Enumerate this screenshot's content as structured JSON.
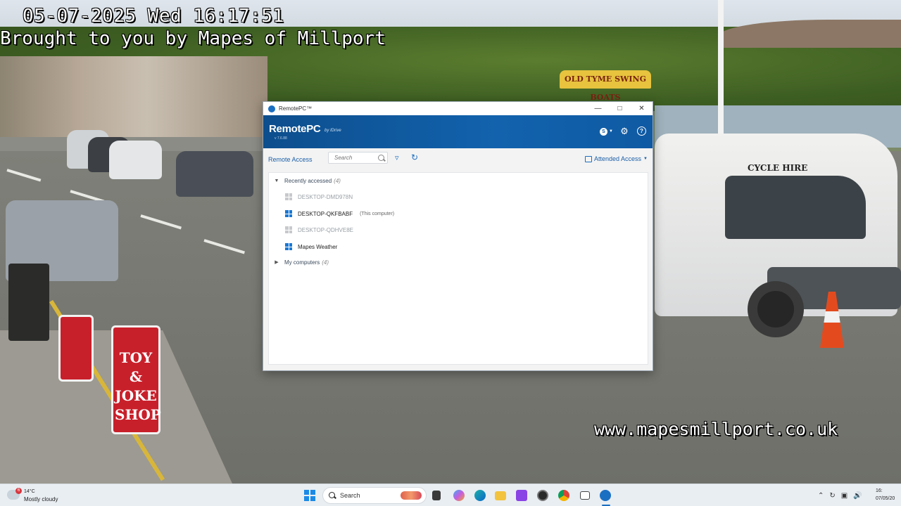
{
  "camera_overlay": {
    "datetime": "05-07-2025 Wed 16:17:51",
    "credit": "Brought to you by Mapes of Millport",
    "website": "www.mapesmillport.co.uk",
    "shop_sign": "TOY & JOKE SHOP",
    "banner": "OLD TYME SWING BOATS",
    "van_text": "CYCLE HIRE"
  },
  "window": {
    "title": "RemotePC™",
    "controls": {
      "minimize": "—",
      "maximize": "□",
      "close": "✕"
    }
  },
  "header": {
    "logo": "RemotePC",
    "logo_sub": "by IDrive",
    "version": "v 7.6.88",
    "user_initial": "S",
    "icons": {
      "user": "user-icon",
      "settings": "gear-icon",
      "help": "help-icon"
    }
  },
  "toolbar": {
    "remote_access_label": "Remote Access",
    "search_placeholder": "Search",
    "attended_access_label": "Attended Access"
  },
  "groups": {
    "recent": {
      "label": "Recently accessed",
      "count": "(4)"
    },
    "mine": {
      "label": "My computers",
      "count": "(4)"
    }
  },
  "computers": [
    {
      "name": "DESKTOP-DMD978N",
      "status": "offline",
      "tag": ""
    },
    {
      "name": "DESKTOP-QKFBABF",
      "status": "online",
      "tag": "(This computer)"
    },
    {
      "name": "DESKTOP-QDHVE8E",
      "status": "offline",
      "tag": ""
    },
    {
      "name": "Mapes Weather",
      "status": "online",
      "tag": ""
    }
  ],
  "taskbar": {
    "weather_temp": "14°C",
    "weather_desc": "Mostly cloudy",
    "weather_badge": "6",
    "search_label": "Search",
    "clock_time": "16:",
    "clock_date": "07/05/20"
  }
}
